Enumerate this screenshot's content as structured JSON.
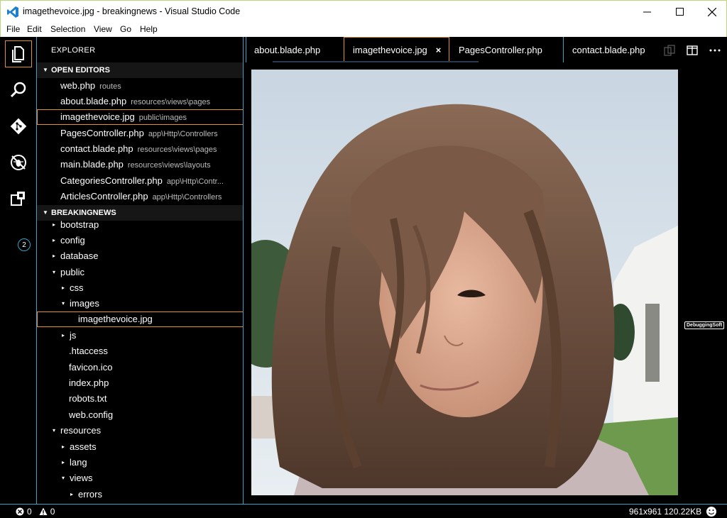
{
  "window": {
    "title": "imagethevoice.jpg - breakingnews - Visual Studio Code"
  },
  "menu": [
    "File",
    "Edit",
    "Selection",
    "View",
    "Go",
    "Help"
  ],
  "activity": {
    "items": [
      "explorer",
      "search",
      "git",
      "debug",
      "extensions"
    ],
    "extensions_badge": "2"
  },
  "sidebar": {
    "title": "EXPLORER",
    "open_editors_label": "OPEN EDITORS",
    "open_editors": [
      {
        "name": "web.php",
        "desc": "routes"
      },
      {
        "name": "about.blade.php",
        "desc": "resources\\views\\pages"
      },
      {
        "name": "imagethevoice.jpg",
        "desc": "public\\images"
      },
      {
        "name": "PagesController.php",
        "desc": "app\\Http\\Controllers"
      },
      {
        "name": "contact.blade.php",
        "desc": "resources\\views\\pages"
      },
      {
        "name": "main.blade.php",
        "desc": "resources\\views\\layouts"
      },
      {
        "name": "CategoriesController.php",
        "desc": "app\\Http\\Contr..."
      },
      {
        "name": "ArticlesController.php",
        "desc": "app\\Http\\Controllers"
      }
    ],
    "project_label": "BREAKINGNEWS",
    "tree": [
      {
        "name": "bootstrap",
        "twisty": "▸"
      },
      {
        "name": "config",
        "twisty": "▸"
      },
      {
        "name": "database",
        "twisty": "▸"
      },
      {
        "name": "public",
        "twisty": "▾"
      },
      {
        "name": "css",
        "twisty": "▸"
      },
      {
        "name": "images",
        "twisty": "▾"
      },
      {
        "name": "imagethevoice.jpg",
        "twisty": ""
      },
      {
        "name": "js",
        "twisty": "▸"
      },
      {
        "name": ".htaccess",
        "twisty": ""
      },
      {
        "name": "favicon.ico",
        "twisty": ""
      },
      {
        "name": "index.php",
        "twisty": ""
      },
      {
        "name": "robots.txt",
        "twisty": ""
      },
      {
        "name": "web.config",
        "twisty": ""
      },
      {
        "name": "resources",
        "twisty": "▾"
      },
      {
        "name": "assets",
        "twisty": "▸"
      },
      {
        "name": "lang",
        "twisty": "▸"
      },
      {
        "name": "views",
        "twisty": "▾"
      },
      {
        "name": "errors",
        "twisty": "▸"
      }
    ]
  },
  "tabs": [
    {
      "label": "about.blade.php"
    },
    {
      "label": "imagethevoice.jpg",
      "close": "×"
    },
    {
      "label": "PagesController.php"
    },
    {
      "label": "contact.blade.php"
    }
  ],
  "editor": {
    "watermark": "DebuggingSoft"
  },
  "status": {
    "errors": "0",
    "warnings": "0",
    "image_info": "961x961 120.22KB"
  },
  "colors": {
    "focus_border": "#e3902b",
    "contrast_border": "#3aa1c8"
  }
}
